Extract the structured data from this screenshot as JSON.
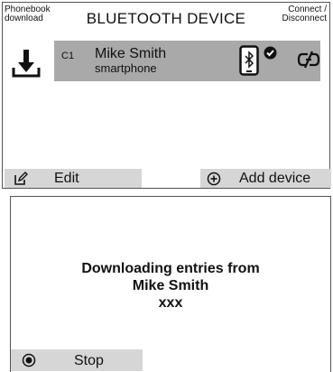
{
  "screen1": {
    "top_left": "Phonebook\ndownload",
    "title": "BLUETOOTH DEVICE",
    "top_right": "Connect /\nDisconnect",
    "device": {
      "slot": "C1",
      "name": "Mike Smith",
      "type": "smartphone",
      "icons": [
        "bluetooth-phone-icon",
        "check-icon"
      ]
    },
    "left_icon": "download-icon",
    "right_icon": "disconnect-icon",
    "softkeys": {
      "edit": "Edit",
      "edit_icon": "edit-icon",
      "add": "Add device",
      "add_icon": "plus-circle-icon"
    }
  },
  "screen2": {
    "line1": "Downloading entries from",
    "line2": "Mike Smith",
    "line3": "xxx",
    "stop": "Stop",
    "stop_icon": "stop-icon"
  },
  "colors": {
    "highlight": "#a9a9a9",
    "softkey": "#d6d6d6",
    "border": "#555555"
  }
}
